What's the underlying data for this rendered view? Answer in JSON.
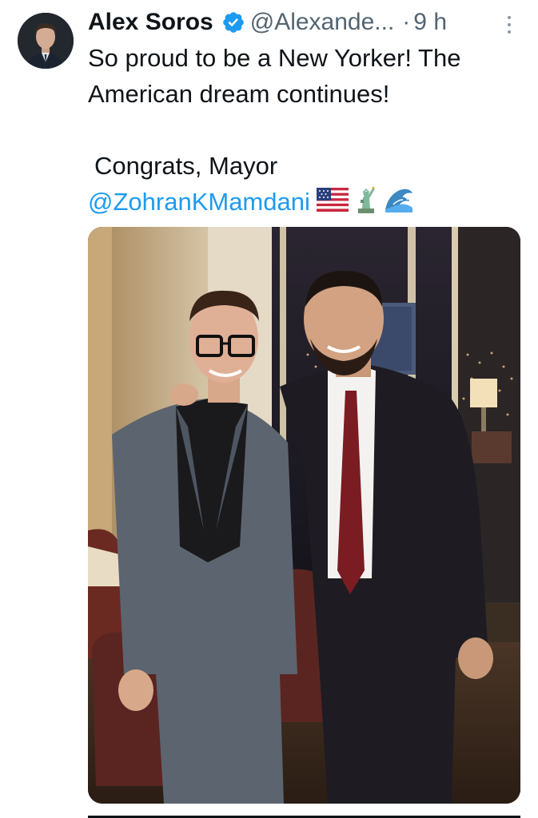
{
  "tweet": {
    "author_name": "Alex Soros",
    "handle": "@Alexande...",
    "separator": "·",
    "time": "9 h",
    "verified_icon": "verified-badge-icon",
    "more_icon": "vertical-dots-icon",
    "text_line_1": "So proud to be a New Yorker! The",
    "text_line_2": "American dream continues!",
    "text_line_3": "Congrats, Mayor",
    "mention": "@ZohranKMamdani",
    "emojis": [
      "us-flag-icon",
      "statue-of-liberty-icon",
      "water-wave-icon"
    ]
  },
  "colors": {
    "accent": "#1d9bf0",
    "text": "#0f1419",
    "muted": "#536471"
  }
}
